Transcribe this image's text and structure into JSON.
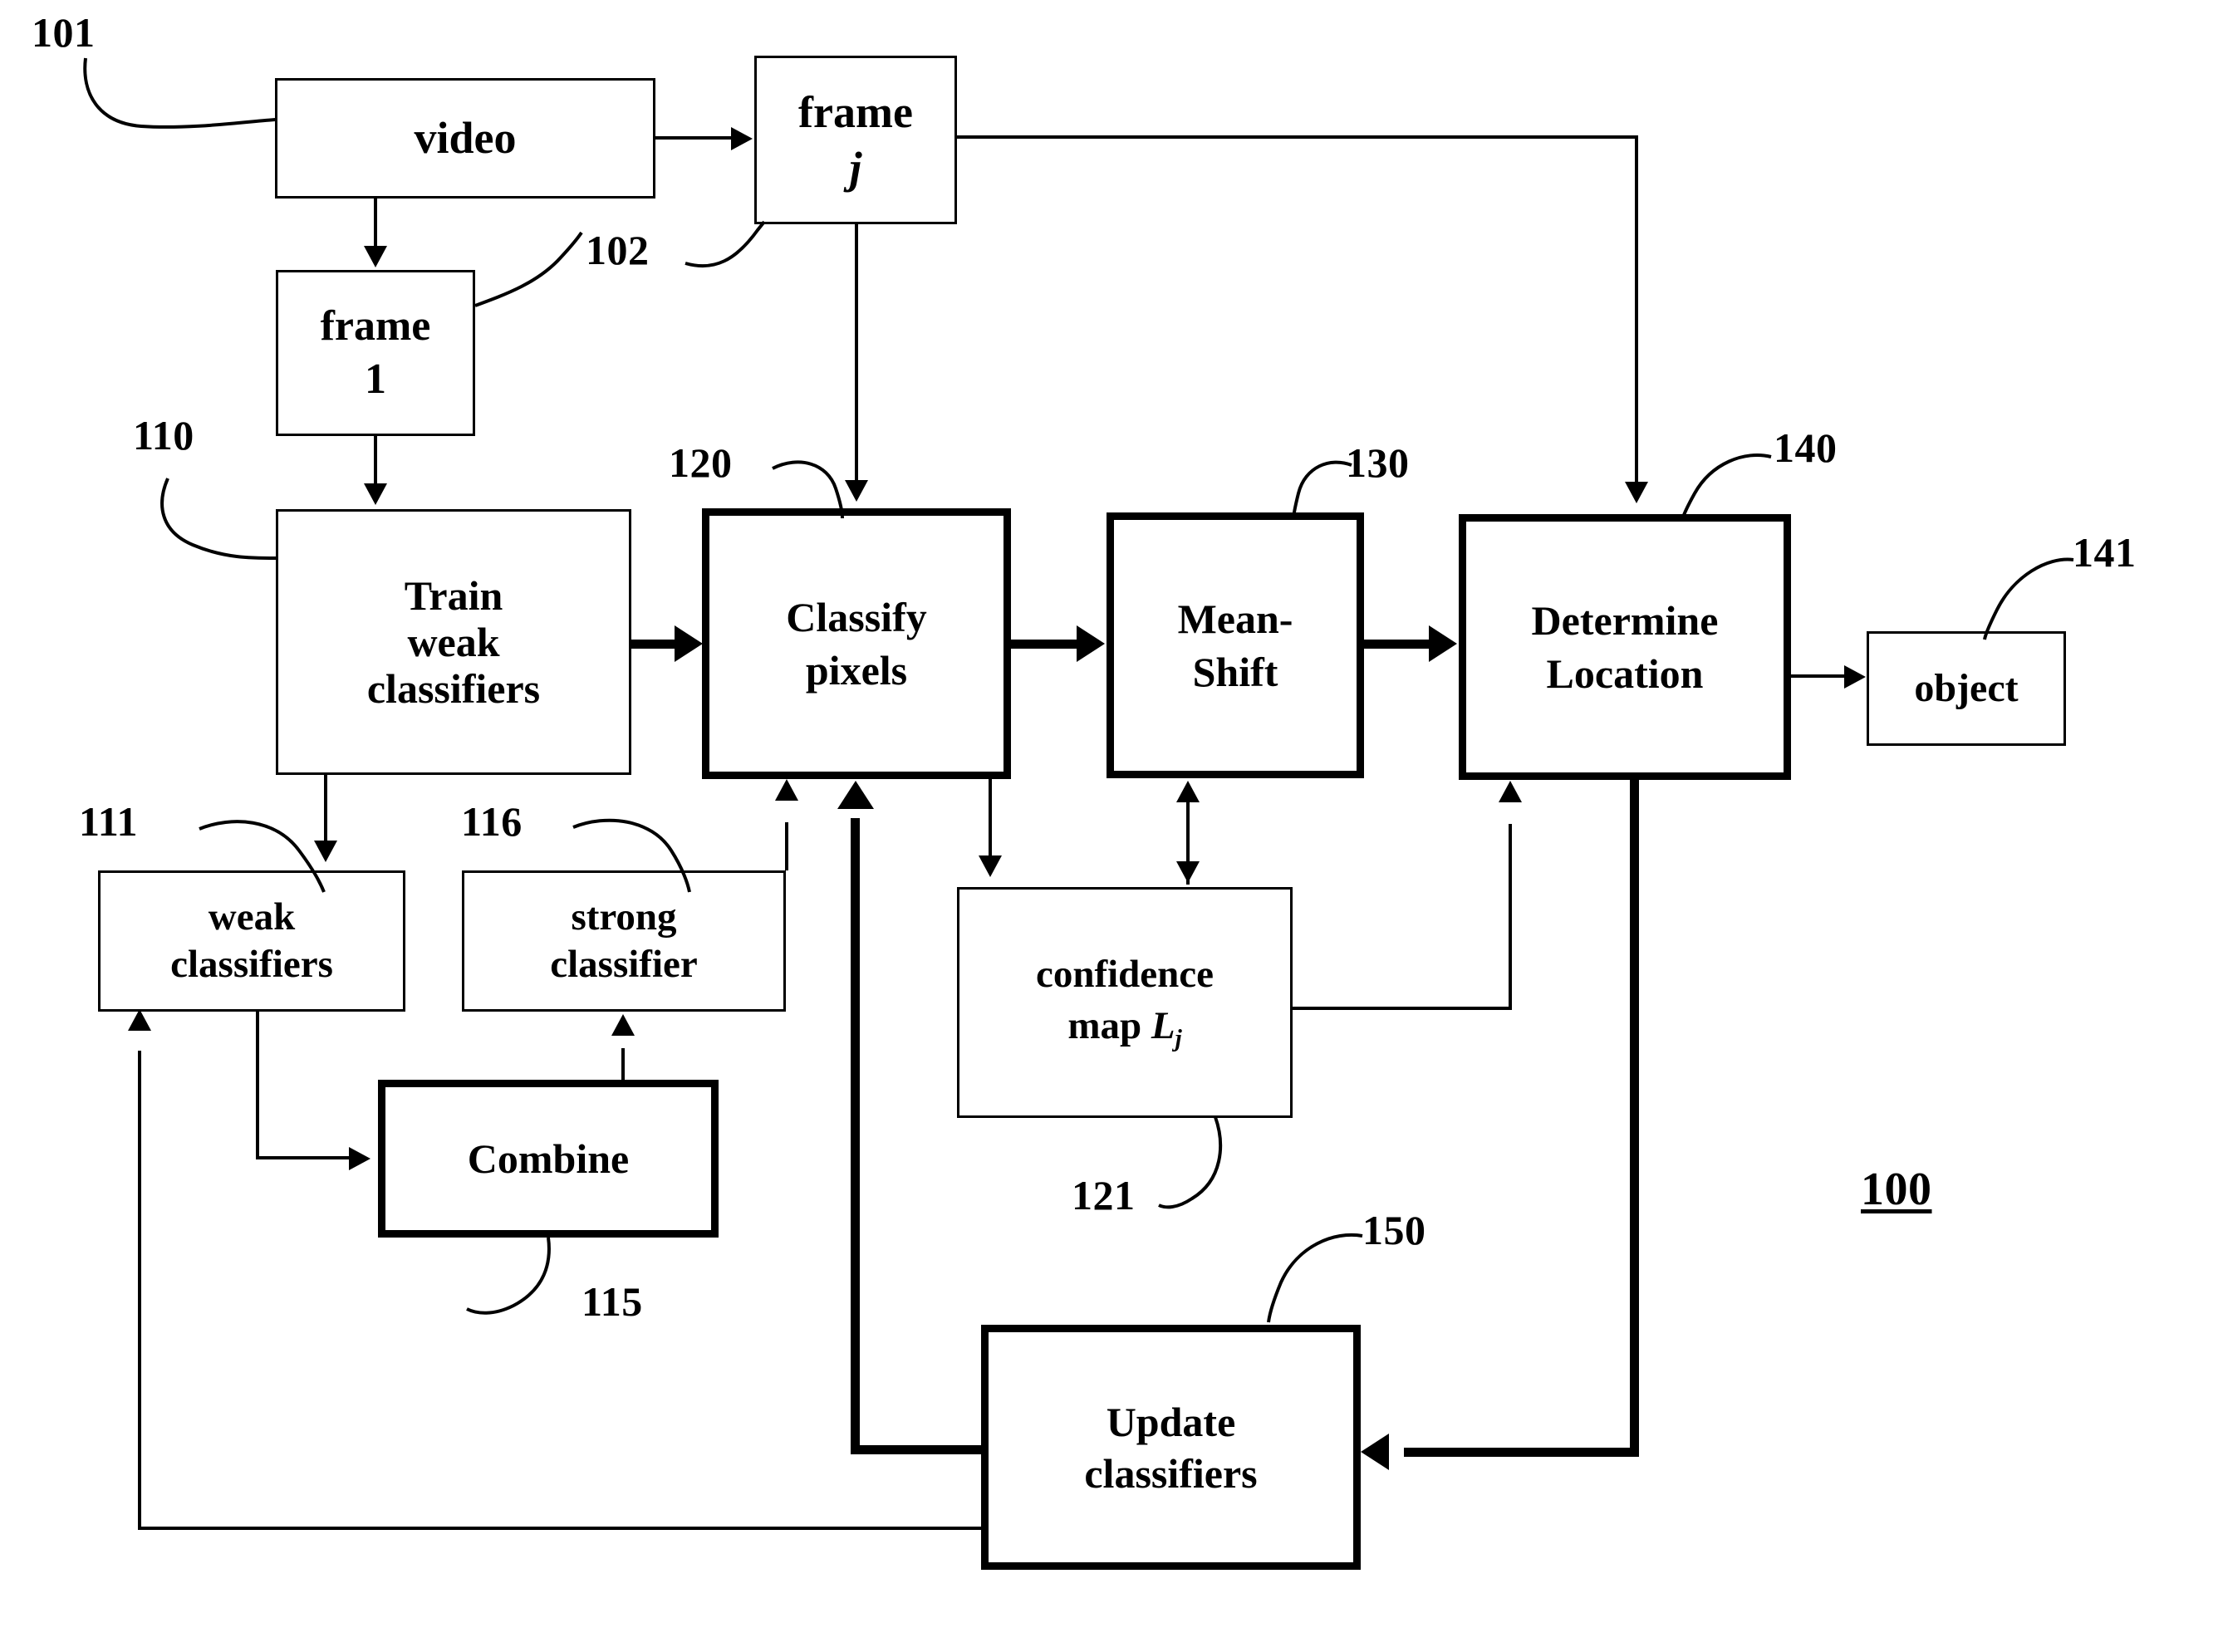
{
  "figure": {
    "number": "100",
    "type": "patent-flow-diagram"
  },
  "boxes": {
    "video": {
      "label": "video",
      "ref": "101"
    },
    "frame_j": {
      "line1": "frame",
      "line2": "j",
      "ref": "102"
    },
    "frame_1": {
      "line1": "frame",
      "line2": "1"
    },
    "train": {
      "line1": "Train",
      "line2": "weak",
      "line3": "classifiers",
      "ref": "110"
    },
    "weak_classifiers": {
      "line1": "weak",
      "line2": "classifiers",
      "ref": "111"
    },
    "strong_classifier": {
      "line1": "strong",
      "line2": "classifier",
      "ref": "116"
    },
    "combine": {
      "label": "Combine",
      "ref": "115"
    },
    "classify": {
      "line1": "Classify",
      "line2": "pixels",
      "ref": "120"
    },
    "confidence_map": {
      "line1": "confidence",
      "line2_pre": "map ",
      "line2_var": "L",
      "line2_sub": "j",
      "ref": "121"
    },
    "mean_shift": {
      "line1": "Mean-",
      "line2": "Shift",
      "ref": "130"
    },
    "determine": {
      "line1": "Determine",
      "line2": "Location",
      "ref": "140"
    },
    "object": {
      "label": "object",
      "ref": "141"
    },
    "update": {
      "line1": "Update",
      "line2": "classifiers",
      "ref": "150"
    }
  },
  "refs": {
    "r101": "101",
    "r102": "102",
    "r110": "110",
    "r111": "111",
    "r115": "115",
    "r116": "116",
    "r120": "120",
    "r121": "121",
    "r130": "130",
    "r140": "140",
    "r141": "141",
    "r150": "150",
    "r100": "100"
  },
  "colors": {
    "stroke": "#000000",
    "background": "#ffffff"
  }
}
